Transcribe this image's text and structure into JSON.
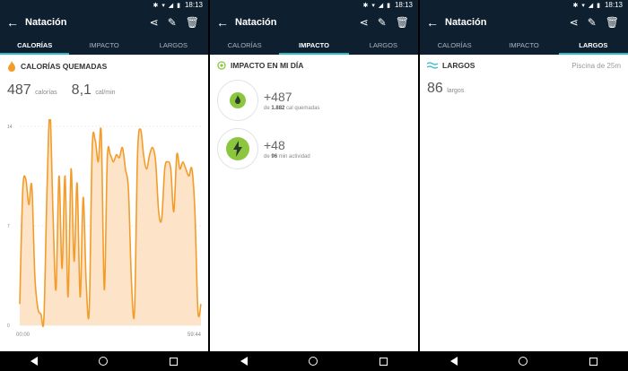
{
  "status": {
    "time": "18:13"
  },
  "app": {
    "title": "Natación"
  },
  "tabs": [
    "CALORÍAS",
    "IMPACTO",
    "LARGOS"
  ],
  "calorias": {
    "header": "CALORÍAS QUEMADAS",
    "total": "487",
    "total_unit": "calorías",
    "rate": "8,1",
    "rate_unit": "cal/min"
  },
  "impacto": {
    "header": "IMPACTO EN MI DÍA",
    "items": [
      {
        "value": "+487",
        "pre": "de",
        "bold": "1.882",
        "post": "cal quemadas",
        "icon": "fire-icon"
      },
      {
        "value": "+48",
        "pre": "de",
        "bold": "96",
        "post": "min actividad",
        "icon": "lightning-icon"
      }
    ]
  },
  "largos": {
    "header": "LARGOS",
    "pool": "Piscina de 25m",
    "count": "86",
    "unit": "largos"
  },
  "colors": {
    "bar": "#0e2030",
    "accent": "#2fb8c6",
    "orange": "#f39c2a",
    "green": "#8cc63f"
  },
  "chart_data": {
    "type": "area",
    "yticks": [
      "14",
      "7",
      "0"
    ],
    "ylim": [
      0,
      14
    ],
    "xticks": [
      "00:00",
      "59:44"
    ],
    "x": [
      0,
      1,
      2,
      3,
      4,
      5,
      6,
      7,
      8,
      9,
      10,
      11,
      12,
      13,
      14,
      15,
      16,
      17,
      18,
      19,
      20,
      21,
      22,
      23,
      24,
      25,
      26,
      27,
      28,
      29,
      30,
      31,
      32,
      33,
      34,
      35,
      36,
      37,
      38,
      39,
      40,
      41,
      42,
      43,
      44,
      45,
      46,
      47,
      48,
      49,
      50,
      51,
      52,
      53,
      54,
      55,
      56,
      57,
      58,
      59,
      60
    ],
    "y": [
      1.5,
      9.5,
      10.3,
      8.5,
      9.8,
      3.5,
      1.2,
      0.8,
      0.5,
      9.3,
      15.0,
      8.0,
      2.5,
      10.5,
      4.0,
      10.5,
      2.0,
      11.0,
      4.5,
      10.0,
      2.0,
      9.0,
      3.0,
      1.0,
      12.5,
      13.0,
      11.5,
      13.5,
      2.5,
      11.8,
      12.0,
      11.5,
      12.0,
      11.8,
      12.5,
      11.0,
      9.5,
      3.0,
      1.0,
      12.0,
      13.8,
      12.0,
      11.0,
      12.0,
      12.5,
      11.5,
      8.0,
      7.5,
      11.0,
      11.5,
      11.0,
      8.0,
      12.0,
      11.0,
      11.5,
      11.0,
      10.5,
      11.0,
      8.0,
      1.0,
      1.5
    ]
  }
}
